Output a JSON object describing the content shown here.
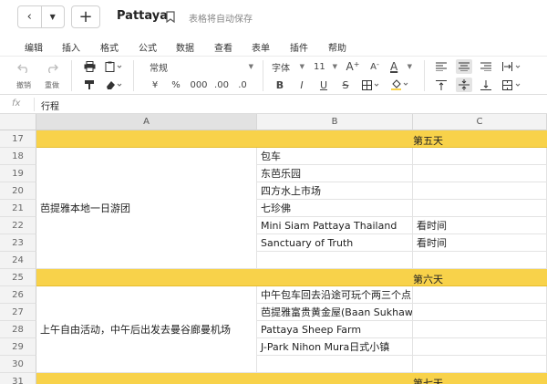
{
  "titlebar": {
    "back_glyph": "‹",
    "dropdown_glyph": "▼",
    "plus_glyph": "+",
    "doc_title": "Pattaya",
    "autosave_text": "表格将自动保存",
    "icons": [
      "back-icon",
      "dropdown-icon",
      "plus-icon",
      "bookmark-icon"
    ]
  },
  "menubar": {
    "items": [
      "编辑",
      "插入",
      "格式",
      "公式",
      "数据",
      "查看",
      "表单",
      "插件",
      "帮助"
    ]
  },
  "toolbar": {
    "undo_label": "撤销",
    "redo_label": "重做",
    "number_format": "常规",
    "currency": "¥",
    "percent": "%",
    "thousands": "000",
    "dec_decrease": ".00",
    "dec_increase": ".0",
    "font_name": "字体",
    "font_size": "11",
    "bold": "B",
    "italic": "I",
    "underline": "U",
    "strike": "S",
    "grow_font": "A",
    "shrink_font": "A",
    "font_color": "A"
  },
  "formula_bar": {
    "fx_label": "fx",
    "value": "行程"
  },
  "columns": [
    {
      "label": "A",
      "active": true
    },
    {
      "label": "B",
      "active": false
    },
    {
      "label": "C",
      "active": false
    }
  ],
  "rows": [
    "17",
    "18",
    "19",
    "20",
    "21",
    "22",
    "23",
    "24",
    "25",
    "26",
    "27",
    "28",
    "29",
    "30",
    "31"
  ],
  "bands": {
    "day5": "第五天",
    "day6": "第六天",
    "day7": "第七天"
  },
  "day5_group": {
    "activity": "芭提雅本地一日游团",
    "b_cells": [
      "包车",
      "东芭乐园",
      "四方水上市场",
      "七珍佛",
      "Mini Siam Pattaya Thailand",
      "Sanctuary of Truth",
      ""
    ],
    "c_cells": [
      "",
      "",
      "",
      "",
      "看时间",
      "看时间",
      ""
    ]
  },
  "day6_group": {
    "activity": "上午自由活动，中午后出发去曼谷廊曼机场",
    "b_cells": [
      "中午包车回去沿途可玩个两三个点",
      "芭提雅富贵黄金屋(Baan Sukhawadee)",
      "Pattaya Sheep Farm",
      "J-Park Nihon Mura日式小镇",
      ""
    ],
    "c_cells": [
      "",
      "",
      "",
      "",
      ""
    ]
  },
  "colors": {
    "band_yellow": "#f8d24a",
    "header_gray": "#f3f3f3"
  }
}
